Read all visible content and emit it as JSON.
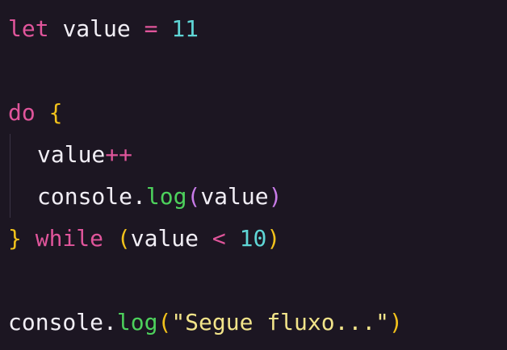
{
  "colors": {
    "background": "#1c1622",
    "keyword": "#e0559b",
    "identifier": "#f1eef5",
    "operator": "#e0559b",
    "number": "#5fd6d6",
    "brace": "#f2c21b",
    "paren_outer": "#f2c21b",
    "paren_inner": "#c87be8",
    "method": "#4dd15c",
    "string": "#f2e48a"
  },
  "code": {
    "line1": {
      "kw": "let",
      "sp1": " ",
      "ident": "value",
      "sp2": " ",
      "op": "=",
      "sp3": " ",
      "num": "11"
    },
    "line3": {
      "kw": "do",
      "sp": " ",
      "brace": "{"
    },
    "line4": {
      "ident": "value",
      "op": "++"
    },
    "line5": {
      "obj": "console",
      "dot": ".",
      "method": "log",
      "lparen": "(",
      "arg": "value",
      "rparen": ")"
    },
    "line6": {
      "brace": "}",
      "sp1": " ",
      "kw": "while",
      "sp2": " ",
      "lparen": "(",
      "ident": "value",
      "sp3": " ",
      "op": "<",
      "sp4": " ",
      "num": "10",
      "rparen": ")"
    },
    "line8": {
      "obj": "console",
      "dot": ".",
      "method": "log",
      "lparen": "(",
      "str": "\"Segue fluxo...\"",
      "rparen": ")"
    }
  }
}
